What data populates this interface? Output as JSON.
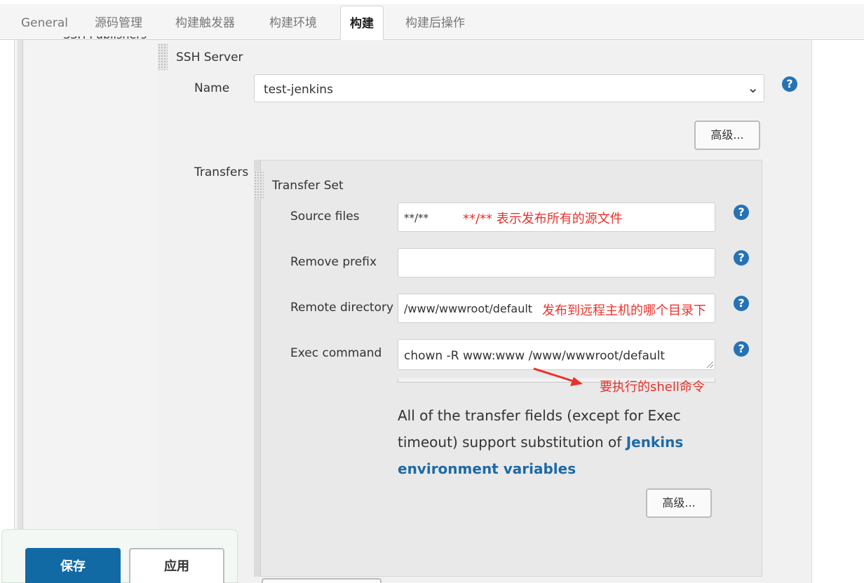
{
  "tabs": [
    {
      "label": "General"
    },
    {
      "label": "源码管理"
    },
    {
      "label": "构建触发器"
    },
    {
      "label": "构建环境"
    },
    {
      "label": "构建"
    },
    {
      "label": "构建后操作"
    }
  ],
  "active_tab": "构建",
  "section_label": "SSH Publishers",
  "ssh_server": {
    "title": "SSH Server",
    "name_label": "Name",
    "name_value": "test-jenkins",
    "advanced_label": "高级..."
  },
  "transfers": {
    "label": "Transfers",
    "set_title": "Transfer Set",
    "source_files": {
      "label": "Source files",
      "value": "**/**",
      "annotation": "**/** 表示发布所有的源文件"
    },
    "remove_prefix": {
      "label": "Remove prefix",
      "value": ""
    },
    "remote_directory": {
      "label": "Remote directory",
      "value": "/www/wwwroot/default",
      "annotation": "发布到远程主机的哪个目录下"
    },
    "exec_command": {
      "label": "Exec command",
      "value": "chown -R www:www /www/wwwroot/default",
      "annotation": "要执行的shell命令"
    },
    "info_text": "All of the transfer fields (except for Exec timeout) support substitution of ",
    "info_link": "Jenkins environment variables",
    "advanced_label": "高级..."
  },
  "footer": {
    "save_label": "保存",
    "apply_label": "应用"
  },
  "colors": {
    "annotation": "#e8322b",
    "primary_button": "#126aa5",
    "help_icon": "#2573b5",
    "link": "#1d6aa5"
  }
}
